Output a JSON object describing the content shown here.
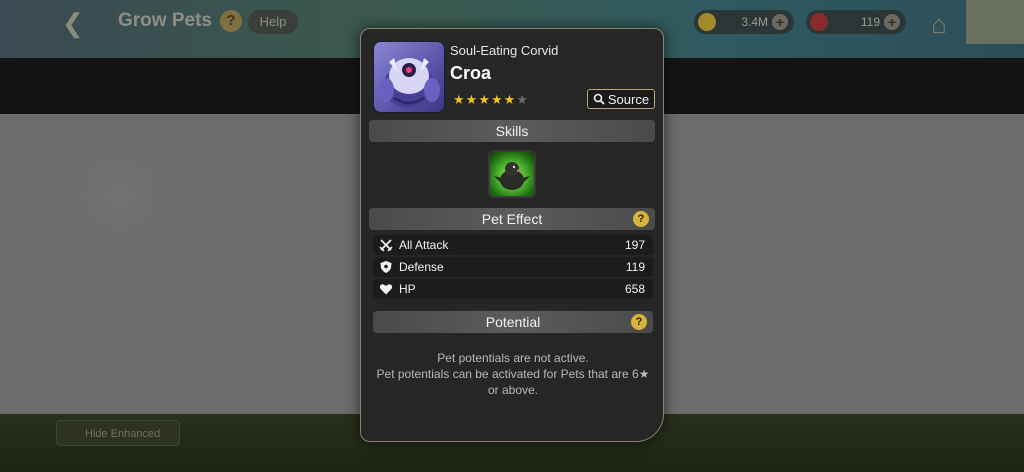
{
  "background": {
    "screen_title": "Grow Pets",
    "help_label": "Help",
    "currency_gold": "3.4M",
    "currency_gem": "119",
    "bottom_button": "Hide Enhanced"
  },
  "pet": {
    "species": "Soul-Eating Corvid",
    "name": "Croa",
    "stars_filled": 5,
    "stars_total": 6,
    "source_label": "Source"
  },
  "sections": {
    "skills": "Skills",
    "pet_effect": "Pet Effect",
    "potential": "Potential",
    "help_glyph": "?"
  },
  "stats": [
    {
      "icon": "crossed-swords-icon",
      "label": "All Attack",
      "value": "197"
    },
    {
      "icon": "shield-icon",
      "label": "Defense",
      "value": "119"
    },
    {
      "icon": "heart-icon",
      "label": "HP",
      "value": "658"
    }
  ],
  "potential_message": {
    "line1": "Pet potentials are not active.",
    "line2": "Pet potentials can be activated for Pets that are 6★",
    "line3": "or above."
  },
  "colors": {
    "star_gold": "#f2c21e",
    "panel_bg": "#262626",
    "panel_border": "#8c8266",
    "help_badge": "#d8b43a"
  }
}
